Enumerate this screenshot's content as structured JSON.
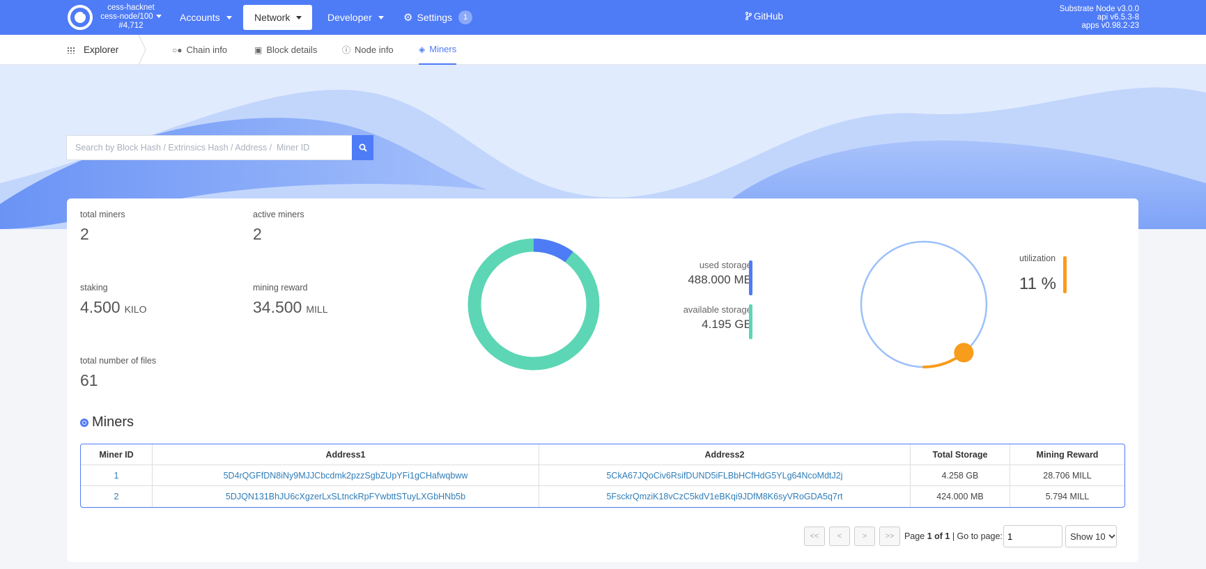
{
  "topbar": {
    "chain_name": "cess-hacknet",
    "node_name": "cess-node/100",
    "block": "#4,712",
    "nav": {
      "accounts": "Accounts",
      "network": "Network",
      "developer": "Developer",
      "settings": "Settings",
      "settings_badge": "1"
    },
    "github": "GitHub",
    "version_node": "Substrate Node v3.0.0",
    "version_api": "api v6.5.3-8",
    "version_apps": "apps v0.98.2-23",
    "accent": "#4e7bf6"
  },
  "subnav": {
    "explorer": "Explorer",
    "tabs": {
      "chain_info": "Chain info",
      "block_details": "Block details",
      "node_info": "Node info",
      "miners": "Miners"
    }
  },
  "search": {
    "placeholder": "Search by Block Hash / Extrinsics Hash / Address /  Miner ID"
  },
  "stats": {
    "total_miners_label": "total miners",
    "total_miners": "2",
    "active_miners_label": "active miners",
    "active_miners": "2",
    "staking_label": "staking",
    "staking": "4.500",
    "staking_unit": "KILO",
    "mining_reward_label": "mining reward",
    "mining_reward": "34.500",
    "mining_reward_unit": "MILL",
    "files_label": "total number of files",
    "files": "61"
  },
  "storage": {
    "used_label": "used storage",
    "used": "488.000 MB",
    "available_label": "available storage",
    "available": "4.195 GB",
    "used_fraction": 0.102,
    "used_color": "#4e7bf6",
    "available_color": "#5cd6b4"
  },
  "utilization": {
    "label": "utilization",
    "value": "11 %",
    "fraction": 0.11,
    "color": "#f89c1c"
  },
  "miners": {
    "title": "Miners",
    "headers": {
      "id": "Miner ID",
      "addr1": "Address1",
      "addr2": "Address2",
      "storage": "Total Storage",
      "reward": "Mining Reward"
    },
    "rows": [
      {
        "id": "1",
        "addr1": "5D4rQGFfDN8iNy9MJJCbcdmk2pzzSgbZUpYFi1gCHafwqbww",
        "addr2": "5CkA67JQoCiv6RsifDUND5iFLBbHCfHdG5YLg64NcoMdtJ2j",
        "storage": "4.258 GB",
        "reward": "28.706 MILL"
      },
      {
        "id": "2",
        "addr1": "5DJQN131BhJU6cXgzerLxSLtnckRpFYwbttSTuyLXGbHNb5b",
        "addr2": "5FsckrQmziK18vCzC5kdV1eBKqi9JDfM8K6syVRoGDA5q7rt",
        "storage": "424.000 MB",
        "reward": "5.794 MILL"
      }
    ]
  },
  "pagination": {
    "first": "<<",
    "prev": "<",
    "next": ">",
    "last": ">>",
    "page_prefix": "Page",
    "page_current": "1 of 1",
    "goto_label": "| Go to page:",
    "goto_value": "1",
    "show": "Show 10"
  }
}
